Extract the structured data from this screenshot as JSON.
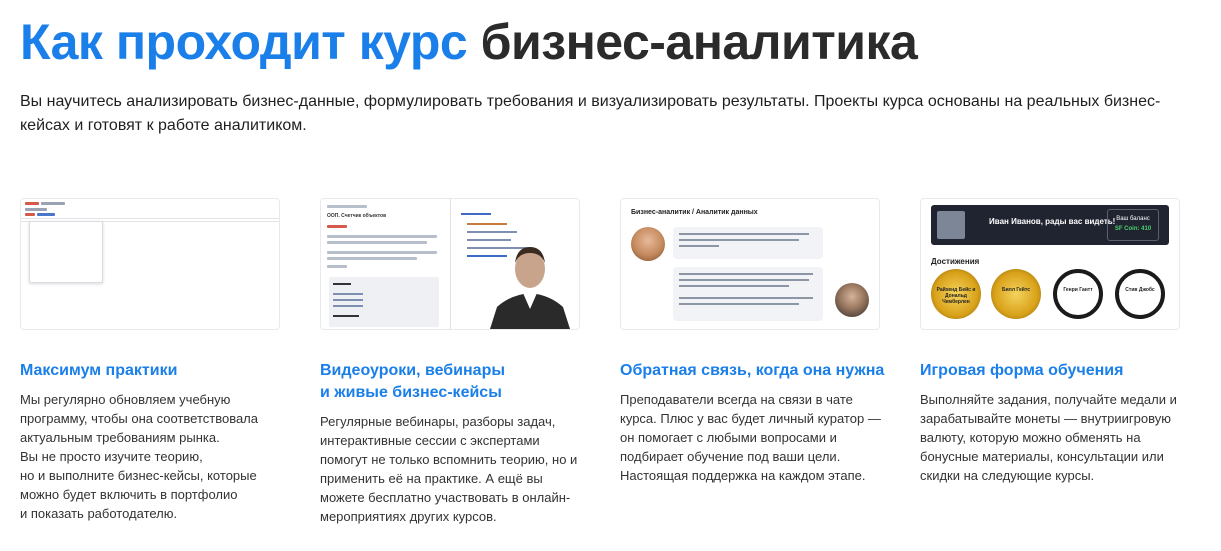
{
  "hero": {
    "title_accent": "Как проходит курс",
    "title_rest": "бизнес-аналитика",
    "description": "Вы научитесь анализировать бизнес-данные, формулировать требования и визуализировать результаты. Проекты курса основаны на реальных бизнес-кейсах и готовят к работе аналитиком."
  },
  "cards": [
    {
      "title": "Максимум практики",
      "text": "Мы регулярно обновляем учебную программу, чтобы она соответствовала актуальным требованиям рынка.\nВы не просто изучите теорию,\nно и выполните бизнес-кейсы, которые можно будет включить в портфолио\nи показать работодателю."
    },
    {
      "title": "Видеоуроки, вебинары\nи живые бизнес-кейсы",
      "text": "Регулярные вебинары, разборы задач, интерактивные сессии с экспертами помогут не только вспомнить теорию, но и применить её на практике. А ещё вы можете бесплатно участвовать в онлайн-мероприятиях других курсов."
    },
    {
      "title": "Обратная связь, когда она нужна",
      "text": "Преподаватели всегда на связи в чате курса. Плюс у вас будет личный куратор — он помогает с любыми вопросами и подбирает обучение под ваши цели. Настоящая поддержка на каждом этапе."
    },
    {
      "title": "Игровая форма обучения",
      "text": "Выполняйте задания, получайте медали и зарабатывайте монеты — внутриигровую валюту, которую можно обменять на бонусные материалы, консультации или скидки на следующие курсы."
    }
  ],
  "images": {
    "video_lesson_title": "OOП. Счетчик объектов",
    "chat_header": "Бизнес-аналитик / Аналитик данных",
    "game_greeting": "Иван Иванов, рады вас видеть!",
    "game_balance_label": "Ваш баланс",
    "game_balance_value": "SF Coin: 410",
    "game_achievements": "Достижения",
    "medals": [
      "Райхенд Бейс и Дональд Чемберлен",
      "Билл Гейтс",
      "Генри Гантт",
      "Стив Джобс"
    ]
  },
  "colors": {
    "accent": "#1a7fe8",
    "dark_text": "#2b2b2b"
  }
}
